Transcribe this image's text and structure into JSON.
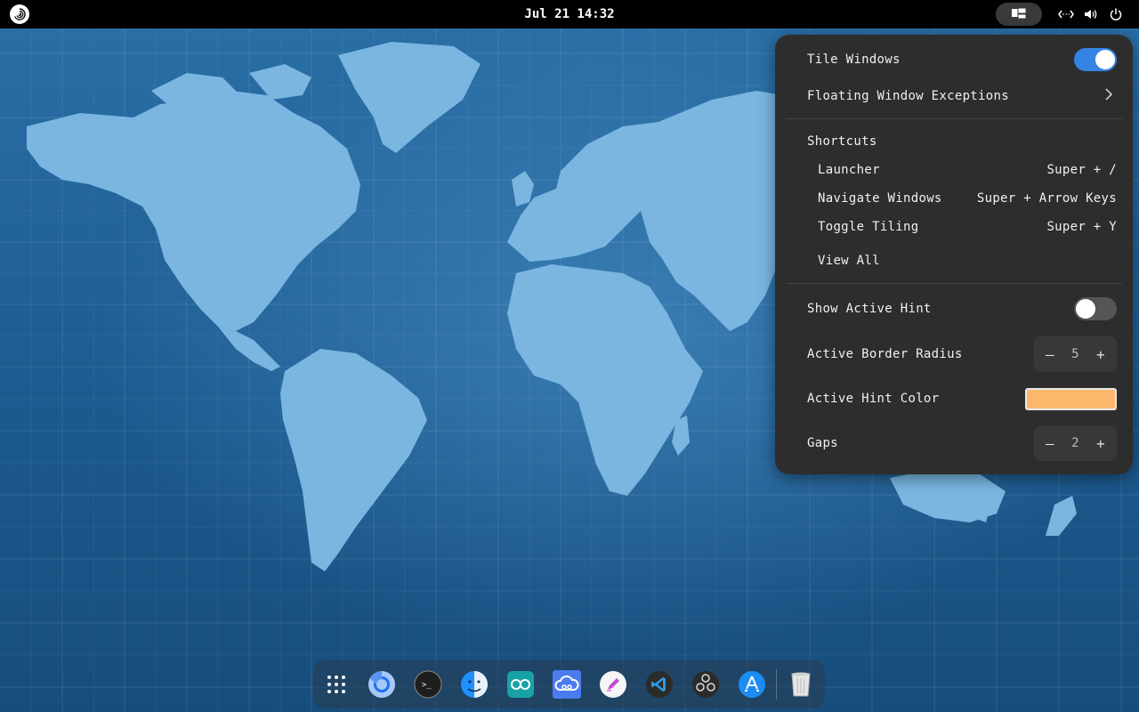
{
  "topbar": {
    "clock": "Jul 21 14:32",
    "logo_icon": "debian-swirl-icon",
    "tiling_icon": "tiling-windows-icon",
    "tray": [
      "network-icon",
      "volume-icon",
      "power-icon"
    ]
  },
  "panel": {
    "tile_windows": {
      "label": "Tile Windows",
      "enabled": true
    },
    "floating_exceptions": {
      "label": "Floating Window Exceptions"
    },
    "shortcuts": {
      "title": "Shortcuts",
      "items": [
        {
          "label": "Launcher",
          "keys": "Super + /"
        },
        {
          "label": "Navigate Windows",
          "keys": "Super + Arrow Keys"
        },
        {
          "label": "Toggle Tiling",
          "keys": "Super + Y"
        }
      ],
      "view_all": "View All"
    },
    "show_active_hint": {
      "label": "Show Active Hint",
      "enabled": false
    },
    "active_border_radius": {
      "label": "Active Border Radius",
      "value": "5",
      "minus": "–",
      "plus": "+"
    },
    "active_hint_color": {
      "label": "Active Hint Color",
      "color": "#fbb86c"
    },
    "gaps": {
      "label": "Gaps",
      "value": "2",
      "minus": "–",
      "plus": "+"
    }
  },
  "dock": {
    "items": [
      "app-grid-icon",
      "chromium-browser-icon",
      "terminal-icon",
      "finder-icon",
      "arduino-icon",
      "cloud-sync-icon",
      "text-editor-icon",
      "vscode-icon",
      "obs-studio-icon",
      "app-store-icon",
      "trash-icon"
    ]
  },
  "colors": {
    "accent": "#3584e4",
    "panel_bg": "#2d2d2d",
    "hint_color": "#fbb86c"
  }
}
